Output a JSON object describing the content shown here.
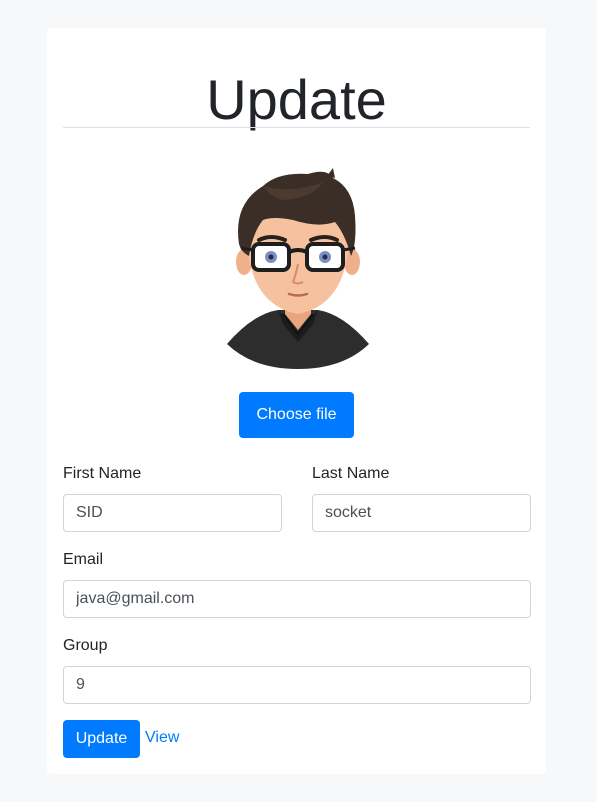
{
  "page": {
    "title": "Update"
  },
  "avatar": {
    "icon": "user-avatar-cartoon"
  },
  "upload": {
    "choose_label": "Choose file"
  },
  "form": {
    "first_name": {
      "label": "First Name",
      "value": "SID"
    },
    "last_name": {
      "label": "Last Name",
      "value": "socket"
    },
    "email": {
      "label": "Email",
      "value": "java@gmail.com"
    },
    "group": {
      "label": "Group",
      "value": "9"
    }
  },
  "actions": {
    "update_label": "Update",
    "view_label": "View"
  },
  "colors": {
    "primary": "#007bff",
    "background": "#f7f8f9",
    "card": "#ffffff",
    "border": "#ced4da"
  }
}
